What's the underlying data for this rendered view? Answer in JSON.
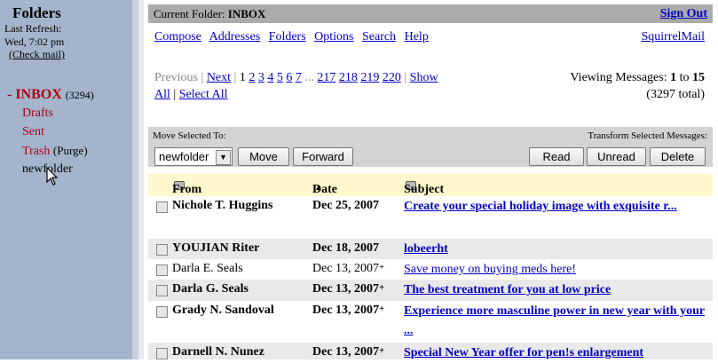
{
  "left": {
    "title": "Folders",
    "last_refresh_label": "Last Refresh:",
    "last_refresh_time": "Wed, 7:02 pm",
    "check_mail": "(Check mail)",
    "inbox_prefix": "- ",
    "inbox": "INBOX",
    "inbox_count": "(3294)",
    "drafts": "Drafts",
    "sent": "Sent",
    "trash": "Trash",
    "purge": "(Purge)",
    "newfolder": "newfolder"
  },
  "header": {
    "current_folder_label": "Current Folder: ",
    "current_folder": "INBOX",
    "sign_out": "Sign Out"
  },
  "nav": {
    "compose": "Compose",
    "addresses": "Addresses",
    "folders": "Folders",
    "options": "Options",
    "search": "Search",
    "help": "Help",
    "brand": "SquirrelMail"
  },
  "pager": {
    "previous": "Previous",
    "next": "Next",
    "current_page": "1",
    "pages": [
      "2",
      "3",
      "4",
      "5",
      "6",
      "7"
    ],
    "ellipsis": "...",
    "last_pages": [
      "217",
      "218",
      "219",
      "220"
    ],
    "show": "Show",
    "all": "All",
    "select_all": "Select All",
    "viewing_label": "Viewing Messages: ",
    "viewing_from": "1",
    "viewing_to_label": " to ",
    "viewing_to": "15",
    "total": "(3297 total)"
  },
  "actions": {
    "move_selected_to": "Move Selected To:",
    "transform_label": "Transform Selected Messages:",
    "folder_select": "newfolder",
    "move": "Move",
    "forward": "Forward",
    "read": "Read",
    "unread": "Unread",
    "delete": "Delete"
  },
  "table": {
    "col_from": "From",
    "col_date": "Date",
    "col_subject": "Subject",
    "rows": [
      {
        "from": "Nichole T. Huggins",
        "date": "Dec 25, 2007",
        "plus": "",
        "subject": "Create your special holiday image with exquisite r...",
        "bold": true
      },
      {
        "from": "YOUJIAN Riter",
        "date": "Dec 18, 2007",
        "plus": "",
        "subject": "lobeerht",
        "bold": true
      },
      {
        "from": "Darla E. Seals",
        "date": "Dec 13, 2007",
        "plus": "+",
        "subject": "Save money on buying meds here!",
        "bold": false
      },
      {
        "from": "Darla G. Seals",
        "date": "Dec 13, 2007",
        "plus": "+",
        "subject": "The best treatment for you at low price",
        "bold": true
      },
      {
        "from": "Grady N. Sandoval",
        "date": "Dec 13, 2007",
        "plus": "+",
        "subject": "Experience more masculine power in new year with your ...",
        "bold": true
      },
      {
        "from": "Darnell N. Nunez",
        "date": "Dec 13, 2007",
        "plus": "+",
        "subject": "Special New Year offer for pen!s enlargement",
        "bold": true
      }
    ]
  }
}
